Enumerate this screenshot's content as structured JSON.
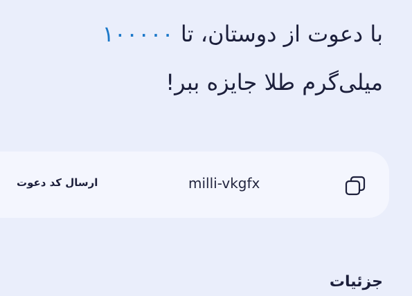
{
  "promo": {
    "line1_prefix": "با دعوت از دوستان، تا ",
    "amount": "۱۰۰۰۰۰",
    "line2": "میلی‌گرم طلا جایزه ببر!"
  },
  "invite": {
    "send_label": "ارسال کد دعوت",
    "code": "milli-vkgfx",
    "copy_icon": "copy-icon"
  },
  "section": {
    "partial_heading": "جزئیات"
  }
}
